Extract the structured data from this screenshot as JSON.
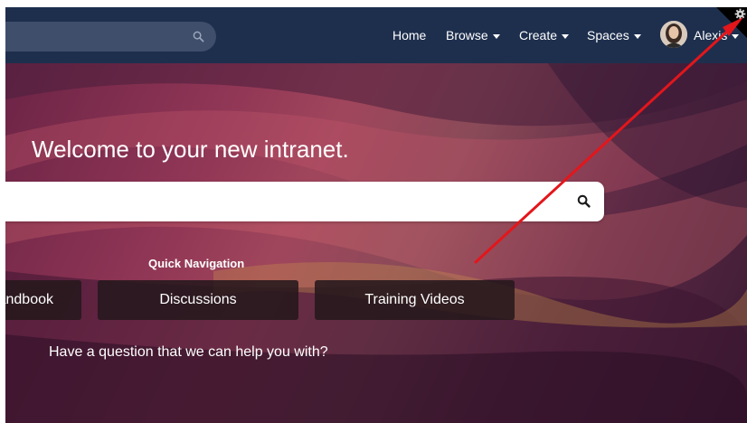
{
  "header": {
    "search_placeholder": "",
    "nav": [
      {
        "label": "Home",
        "has_caret": false
      },
      {
        "label": "Browse",
        "has_caret": true
      },
      {
        "label": "Create",
        "has_caret": true
      },
      {
        "label": "Spaces",
        "has_caret": true
      }
    ],
    "user_name": "Alexis"
  },
  "hero": {
    "welcome_text": "Welcome to your new intranet.",
    "search_placeholder": "",
    "quick_nav_title": "Quick Navigation",
    "quick_nav_buttons": [
      "Handbook",
      "Discussions",
      "Training Videos"
    ],
    "question_text": "Have a question that we can help you with?"
  },
  "colors": {
    "header_bg": "#1e2f4e",
    "annotation_arrow": "#e3161b"
  },
  "icons": [
    "search-icon",
    "gear-icon",
    "avatar-photo",
    "caret-down-icon"
  ]
}
